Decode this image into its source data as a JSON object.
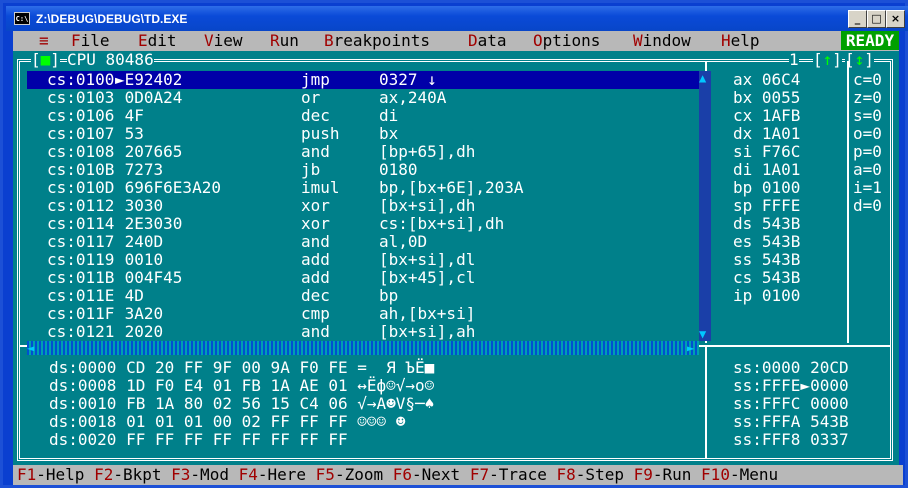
{
  "window": {
    "title": "Z:\\DEBUG\\DEBUG\\TD.EXE",
    "icon": "msdos-icon",
    "min": "_",
    "max": "□",
    "close": "×"
  },
  "menu": {
    "items": [
      {
        "hot": "≡",
        "rest": ""
      },
      {
        "hot": "F",
        "rest": "ile"
      },
      {
        "hot": "E",
        "rest": "dit"
      },
      {
        "hot": "V",
        "rest": "iew"
      },
      {
        "hot": "R",
        "rest": "un"
      },
      {
        "hot": "B",
        "rest": "reakpoints"
      },
      {
        "hot": "D",
        "rest": "ata"
      },
      {
        "hot": "O",
        "rest": "ptions"
      },
      {
        "hot": "W",
        "rest": "indow"
      },
      {
        "hot": "H",
        "rest": "elp"
      }
    ],
    "status": "READY"
  },
  "cpu": {
    "title": "CPU 80486",
    "window_number": "1",
    "code": [
      {
        "addr": "cs:0100",
        "bytes": "►E92402",
        "op": "jmp",
        "args": "0327 ↓"
      },
      {
        "addr": "cs:0103",
        "bytes": " 0D0A24",
        "op": "or",
        "args": "ax,240A"
      },
      {
        "addr": "cs:0106",
        "bytes": " 4F",
        "op": "dec",
        "args": "di"
      },
      {
        "addr": "cs:0107",
        "bytes": " 53",
        "op": "push",
        "args": "bx"
      },
      {
        "addr": "cs:0108",
        "bytes": " 207665",
        "op": "and",
        "args": "[bp+65],dh"
      },
      {
        "addr": "cs:010B",
        "bytes": " 7273",
        "op": "jb",
        "args": "0180"
      },
      {
        "addr": "cs:010D",
        "bytes": " 696F6E3A20",
        "op": "imul",
        "args": "bp,[bx+6E],203A"
      },
      {
        "addr": "cs:0112",
        "bytes": " 3030",
        "op": "xor",
        "args": "[bx+si],dh"
      },
      {
        "addr": "cs:0114",
        "bytes": " 2E3030",
        "op": "xor",
        "args": "cs:[bx+si],dh"
      },
      {
        "addr": "cs:0117",
        "bytes": " 240D",
        "op": "and",
        "args": "al,0D"
      },
      {
        "addr": "cs:0119",
        "bytes": " 0010",
        "op": "add",
        "args": "[bx+si],dl"
      },
      {
        "addr": "cs:011B",
        "bytes": " 004F45",
        "op": "add",
        "args": "[bx+45],cl"
      },
      {
        "addr": "cs:011E",
        "bytes": " 4D",
        "op": "dec",
        "args": "bp"
      },
      {
        "addr": "cs:011F",
        "bytes": " 3A20",
        "op": "cmp",
        "args": "ah,[bx+si]"
      },
      {
        "addr": "cs:0121",
        "bytes": " 2020",
        "op": "and",
        "args": "[bx+si],ah"
      }
    ],
    "registers": [
      "ax 06C4",
      "bx 0055",
      "cx 1AFB",
      "dx 1A01",
      "si F76C",
      "di 1A01",
      "bp 0100",
      "sp FFFE",
      "ds 543B",
      "es 543B",
      "ss 543B",
      "cs 543B",
      "ip 0100"
    ],
    "flags": [
      "c=0",
      "z=0",
      "s=0",
      "o=0",
      "p=0",
      "a=0",
      "i=1",
      "d=0"
    ],
    "dump": [
      "ds:0000 CD 20 FF 9F 00 9A F0 FE =  Я ЪЁ■",
      "ds:0008 1D F0 E4 01 FB 1A AE 01 ↔Ёф☺√→о☺",
      "ds:0010 FB 1A 80 02 56 15 C4 06 √→А☻V§─♠",
      "ds:0018 01 01 01 00 02 FF FF FF ☺☺☺ ☻",
      "ds:0020 FF FF FF FF FF FF FF FF"
    ],
    "stack": [
      "ss:0000 20CD",
      "ss:FFFE►0000",
      "ss:FFFC 0000",
      "ss:FFFA 543B",
      "ss:FFF8 0337"
    ]
  },
  "statusbar": [
    {
      "key": "F1",
      "label": "-Help"
    },
    {
      "key": "F2",
      "label": "-Bkpt"
    },
    {
      "key": "F3",
      "label": "-Mod"
    },
    {
      "key": "F4",
      "label": "-Here"
    },
    {
      "key": "F5",
      "label": "-Zoom"
    },
    {
      "key": "F6",
      "label": "-Next"
    },
    {
      "key": "F7",
      "label": "-Trace"
    },
    {
      "key": "F8",
      "label": "-Step"
    },
    {
      "key": "F9",
      "label": "-Run"
    },
    {
      "key": "F10",
      "label": "-Menu"
    }
  ]
}
